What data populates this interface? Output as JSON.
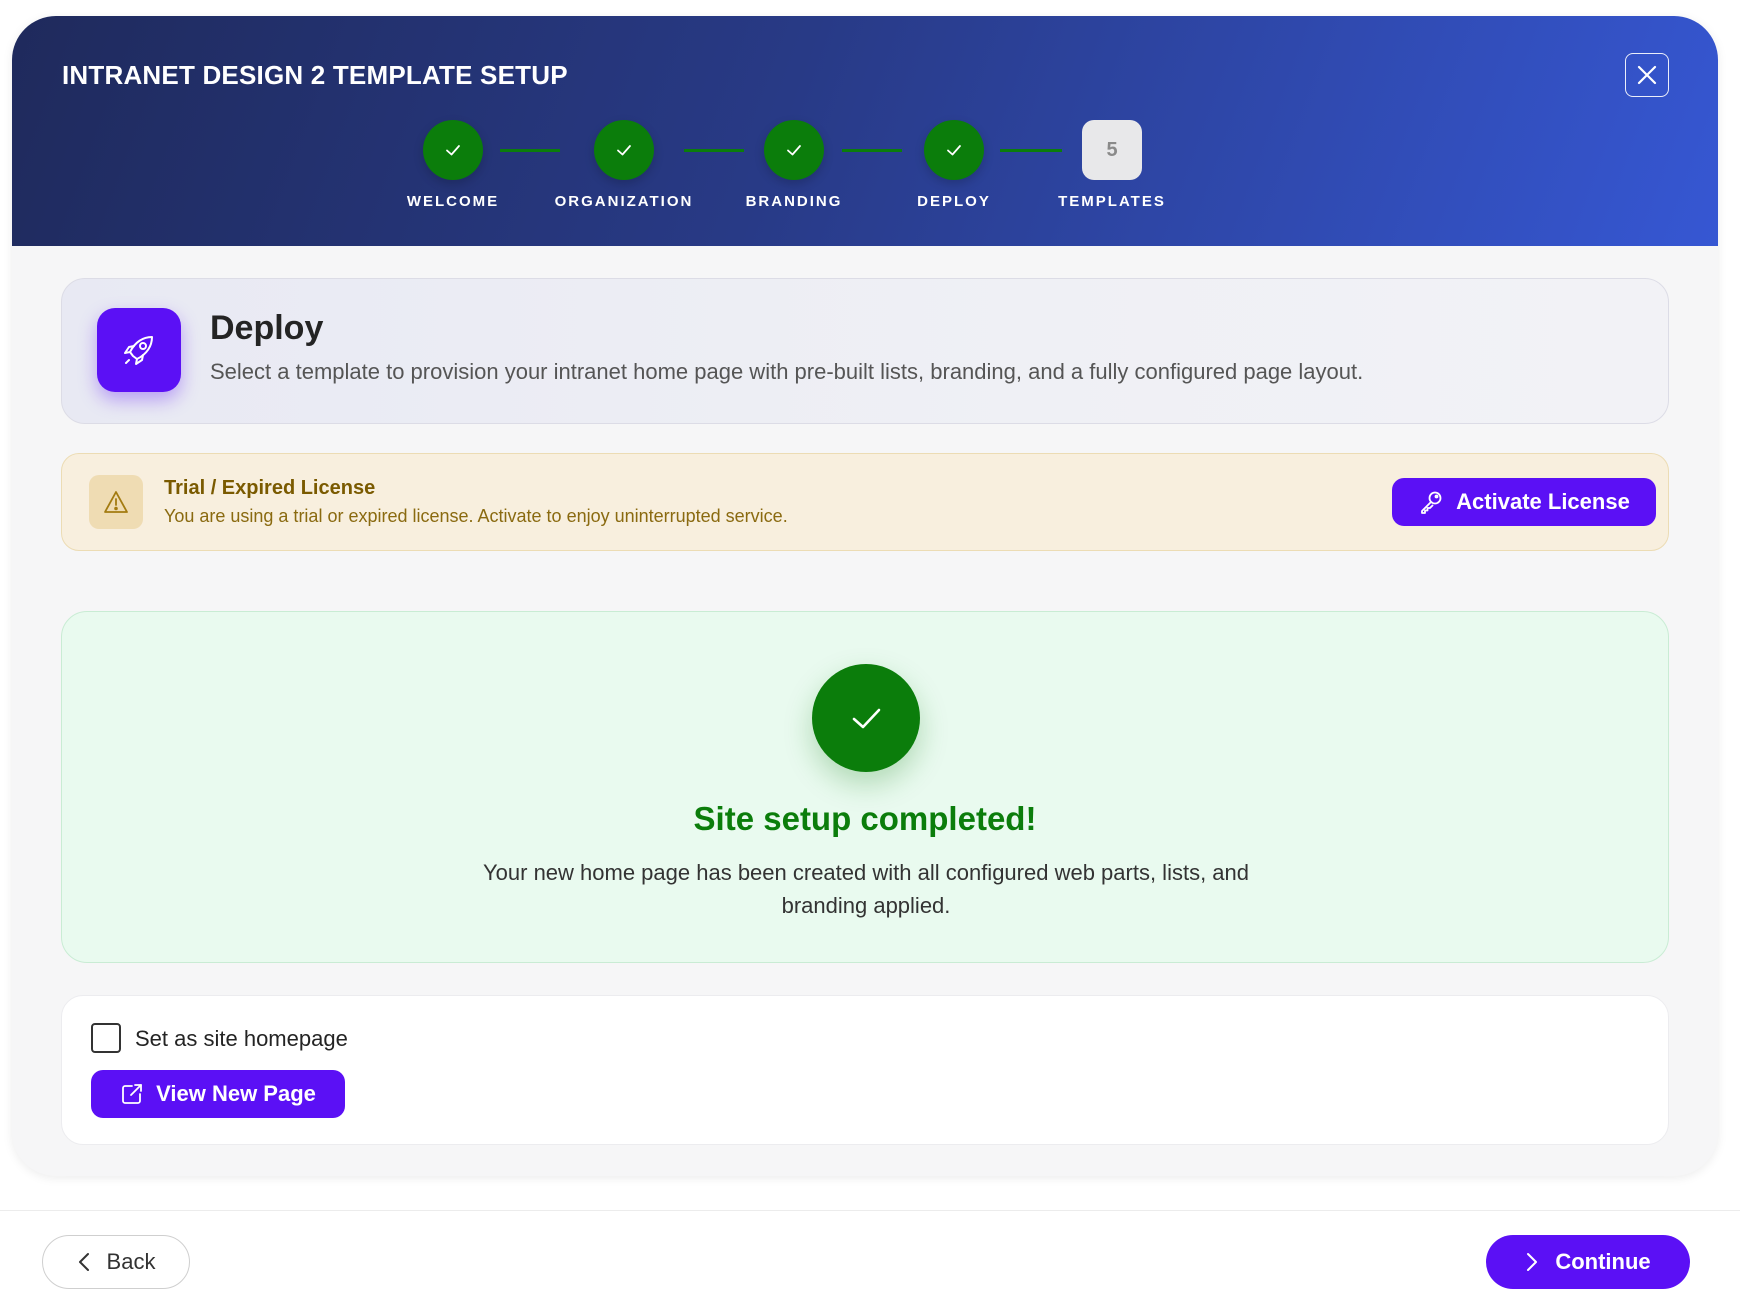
{
  "window": {
    "title": "INTRANET DESIGN 2 TEMPLATE SETUP"
  },
  "steps": [
    {
      "label": "WELCOME",
      "status": "complete"
    },
    {
      "label": "ORGANIZATION",
      "status": "complete"
    },
    {
      "label": "BRANDING",
      "status": "complete"
    },
    {
      "label": "DEPLOY",
      "status": "complete"
    },
    {
      "label": "TEMPLATES",
      "status": "current",
      "number": "5"
    }
  ],
  "deploy": {
    "title": "Deploy",
    "description": "Select a template to provision your intranet home page with pre-built lists, branding, and a fully configured page layout.",
    "icon": "rocket-icon"
  },
  "license": {
    "title": "Trial / Expired License",
    "description": "You are using a trial or expired license. Activate to enjoy uninterrupted service.",
    "button_label": "Activate License",
    "icon": "warning-icon"
  },
  "success": {
    "title": "Site setup completed!",
    "description": "Your new home page has been created with all configured web parts, lists, and branding applied."
  },
  "actions": {
    "homepage_checkbox_label": "Set as site homepage",
    "homepage_checked": false,
    "view_button_label": "View New Page"
  },
  "footer": {
    "back_label": "Back",
    "continue_label": "Continue"
  },
  "colors": {
    "accent": "#5b10f5",
    "success": "#0b7d0b",
    "header_start": "#1f2a5c",
    "header_end": "#3657d3",
    "warning_text": "#7a5a00"
  }
}
